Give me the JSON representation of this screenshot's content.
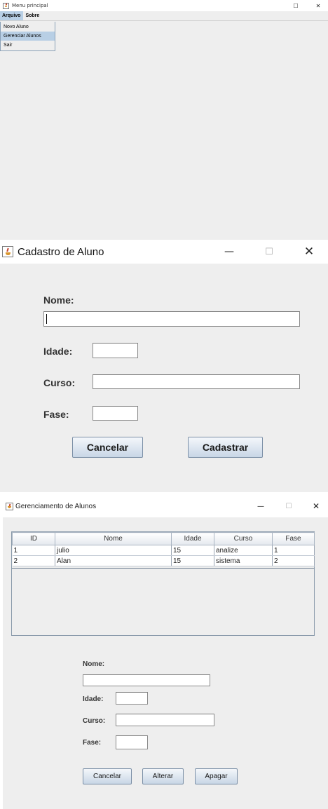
{
  "menu_window": {
    "title": "Menu principal",
    "menubar": [
      "Arquivo",
      "Sobre"
    ],
    "dropdown": [
      "Novo Aluno",
      "Gerenciar Alunos",
      "Sair"
    ]
  },
  "cadastro_window": {
    "title": "Cadastro de Aluno",
    "labels": {
      "nome": "Nome:",
      "idade": "Idade:",
      "curso": "Curso:",
      "fase": "Fase:"
    },
    "values": {
      "nome": "",
      "idade": "",
      "curso": "",
      "fase": ""
    },
    "buttons": {
      "cancel": "Cancelar",
      "submit": "Cadastrar"
    }
  },
  "gerenciamento_window": {
    "title": "Gerenciamento de Alunos",
    "table": {
      "columns": [
        "ID",
        "Nome",
        "Idade",
        "Curso",
        "Fase"
      ],
      "rows": [
        [
          "1",
          "julio",
          "15",
          "analize",
          "1"
        ],
        [
          "2",
          "Alan",
          "15",
          "sistema",
          "2"
        ]
      ]
    },
    "labels": {
      "nome": "Nome:",
      "idade": "Idade:",
      "curso": "Curso:",
      "fase": "Fase:"
    },
    "values": {
      "nome": "",
      "idade": "",
      "curso": "",
      "fase": ""
    },
    "buttons": {
      "cancel": "Cancelar",
      "update": "Alterar",
      "delete": "Apagar"
    }
  },
  "window_controls": {
    "minimize": "—",
    "maximize": "☐",
    "close": "✕"
  },
  "icons": {
    "app": "java-cup-icon"
  }
}
